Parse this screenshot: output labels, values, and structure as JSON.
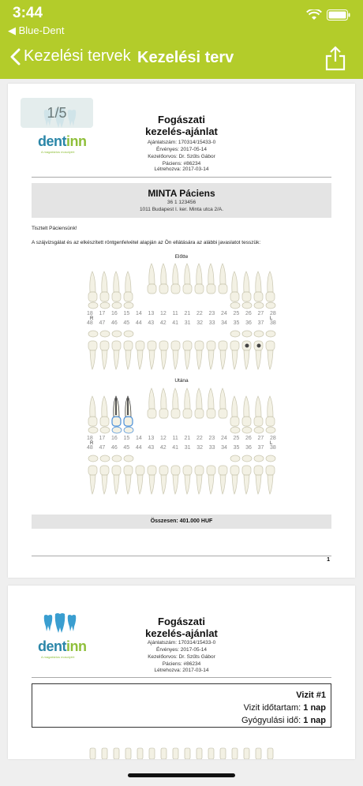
{
  "status_bar": {
    "time": "3:44",
    "back_app": "Blue-Dent"
  },
  "nav": {
    "back_label": "Kezelési tervek",
    "title": "Kezelési terv"
  },
  "page_indicator": "1/5",
  "logo": {
    "brand_a": "dent",
    "brand_b": "inn",
    "tagline": "A magabiztos mosolyért"
  },
  "document": {
    "title_line1": "Fogászati",
    "title_line2": "kezelés-ajánlat",
    "offer_number": "Ajánlatszám: 170314/15433-0",
    "valid_until": "Érvényes: 2017-05-14",
    "doctor": "Kezelőorvos: Dr. Szűts Gábor",
    "patient_id": "Páciens: #86234",
    "created": "Létrehozva: 2017-03-14"
  },
  "patient": {
    "name": "MINTA Páciens",
    "phone": "36 1 123456",
    "address": "1011 Budapest I. ker. Minta utca 2/A."
  },
  "greeting": "Tisztelt Páciensünk!",
  "intro": "A szájvizsgálat és az elkészített röntgenfelvétel alapján az Ön ellátására az alábbi javaslatot tesszük:",
  "chart_before_label": "Előtte",
  "chart_after_label": "Utána",
  "upper_numbers": [
    "18",
    "17",
    "16",
    "15",
    "14",
    "13",
    "12",
    "11",
    "21",
    "22",
    "23",
    "24",
    "25",
    "26",
    "27",
    "28"
  ],
  "lower_numbers": [
    "48",
    "47",
    "46",
    "45",
    "44",
    "43",
    "42",
    "41",
    "31",
    "32",
    "33",
    "34",
    "35",
    "36",
    "37",
    "38"
  ],
  "side_right": "R",
  "side_left": "L",
  "total": "Összesen: 401.000 HUF",
  "page_number": "1",
  "visit": {
    "title": "Vizit #1",
    "duration_label": "Vizit időtartam:",
    "duration_value": "1 nap",
    "healing_label": "Gyógyulási idő:",
    "healing_value": "1 nap"
  },
  "colors": {
    "accent": "#b3cc2a",
    "highlight_tooth": "#4a90d9"
  }
}
